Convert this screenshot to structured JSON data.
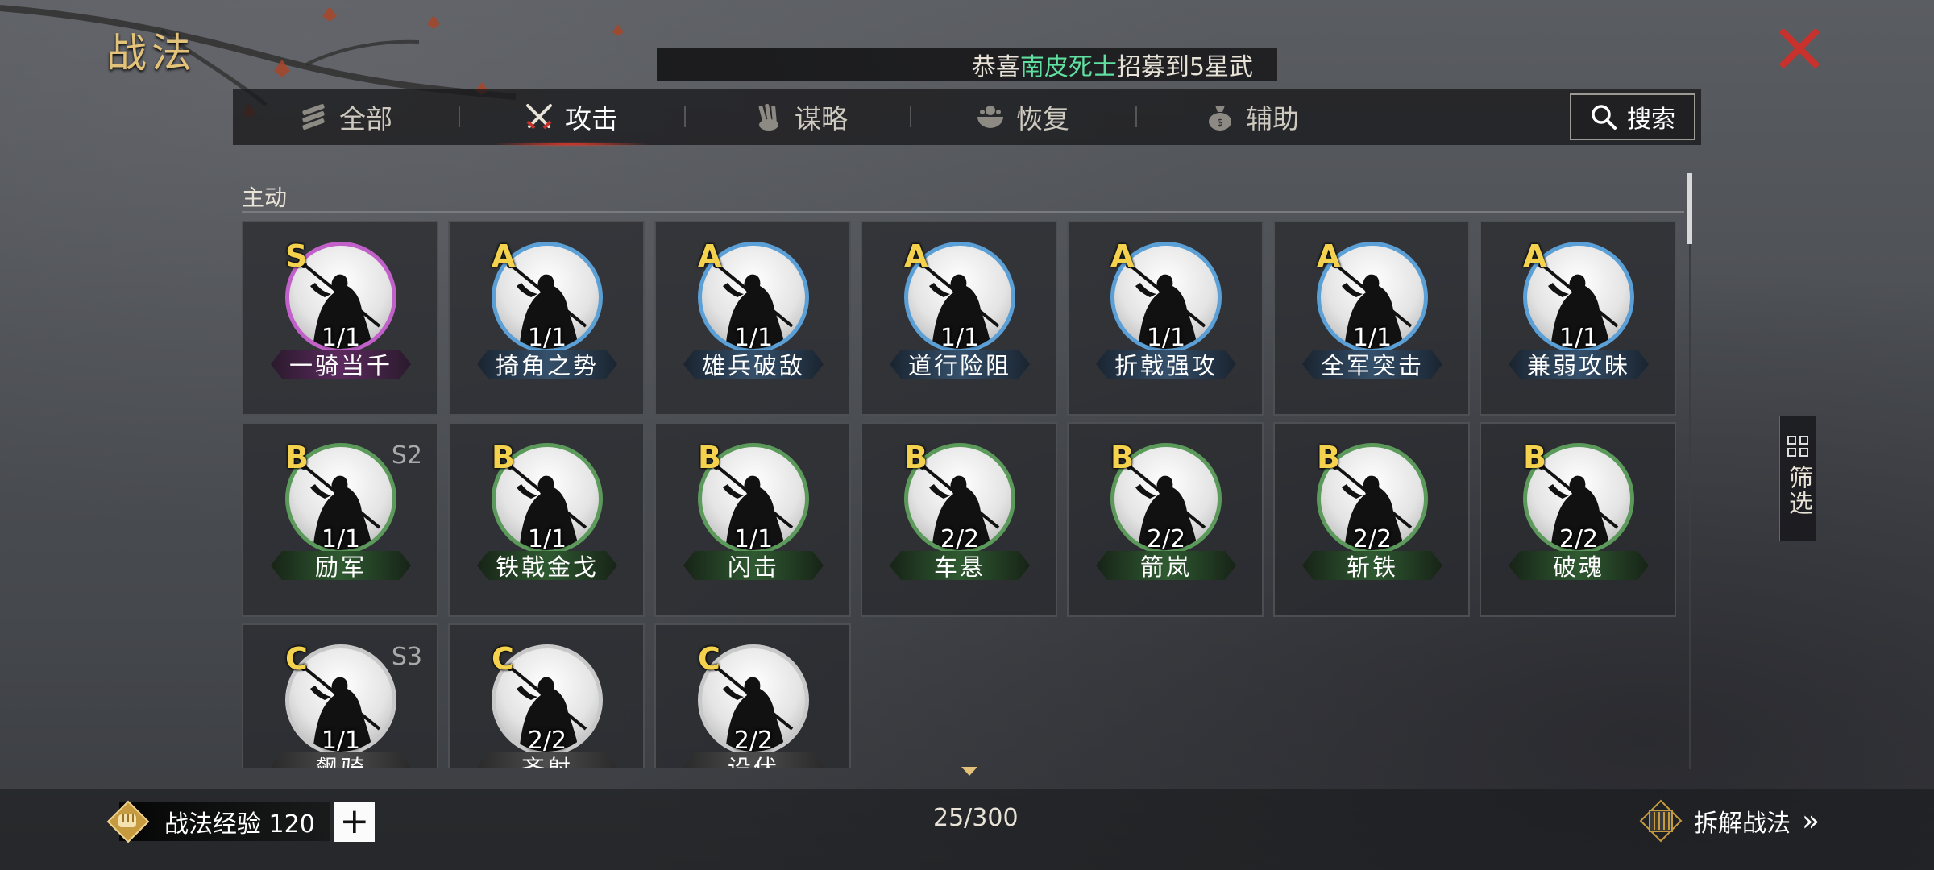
{
  "window": {
    "title": "战法",
    "close_icon": "close-icon"
  },
  "banner": {
    "prefix": "恭喜",
    "highlight": "南皮死士",
    "suffix": "招募到5星武",
    "highlight_color": "#5fe0a0"
  },
  "tabs": [
    {
      "label": "全部",
      "icon": "all-scrolls-icon"
    },
    {
      "label": "攻击",
      "icon": "crossed-swords-icon",
      "active": true
    },
    {
      "label": "谋略",
      "icon": "strategy-hand-icon"
    },
    {
      "label": "恢复",
      "icon": "restore-bowl-icon"
    },
    {
      "label": "辅助",
      "icon": "support-bag-icon"
    }
  ],
  "search": {
    "label": "搜索",
    "icon": "search-icon"
  },
  "section": {
    "label": "主动"
  },
  "cards": [
    {
      "grade": "S",
      "count": "1/1",
      "name": "一骑当千",
      "season": ""
    },
    {
      "grade": "A",
      "count": "1/1",
      "name": "掎角之势",
      "season": ""
    },
    {
      "grade": "A",
      "count": "1/1",
      "name": "雄兵破敌",
      "season": ""
    },
    {
      "grade": "A",
      "count": "1/1",
      "name": "道行险阻",
      "season": ""
    },
    {
      "grade": "A",
      "count": "1/1",
      "name": "折戟强攻",
      "season": ""
    },
    {
      "grade": "A",
      "count": "1/1",
      "name": "全军突击",
      "season": ""
    },
    {
      "grade": "A",
      "count": "1/1",
      "name": "兼弱攻昧",
      "season": ""
    },
    {
      "grade": "B",
      "count": "1/1",
      "name": "励军",
      "season": "S2"
    },
    {
      "grade": "B",
      "count": "1/1",
      "name": "铁戟金戈",
      "season": ""
    },
    {
      "grade": "B",
      "count": "1/1",
      "name": "闪击",
      "season": ""
    },
    {
      "grade": "B",
      "count": "2/2",
      "name": "车悬",
      "season": ""
    },
    {
      "grade": "B",
      "count": "2/2",
      "name": "箭岚",
      "season": ""
    },
    {
      "grade": "B",
      "count": "2/2",
      "name": "斩铁",
      "season": ""
    },
    {
      "grade": "B",
      "count": "2/2",
      "name": "破魂",
      "season": ""
    },
    {
      "grade": "C",
      "count": "1/1",
      "name": "飙骑",
      "season": "S3"
    },
    {
      "grade": "C",
      "count": "2/2",
      "name": "齐射",
      "season": ""
    },
    {
      "grade": "C",
      "count": "2/2",
      "name": "设伏",
      "season": ""
    }
  ],
  "filter": {
    "label": "筛选",
    "icon": "filter-grid-icon"
  },
  "bottom": {
    "exp_label": "战法经验 120",
    "add_label": "+",
    "pager": "25/300",
    "dismantle_label": "拆解战法",
    "dismantle_arrows": "»"
  }
}
